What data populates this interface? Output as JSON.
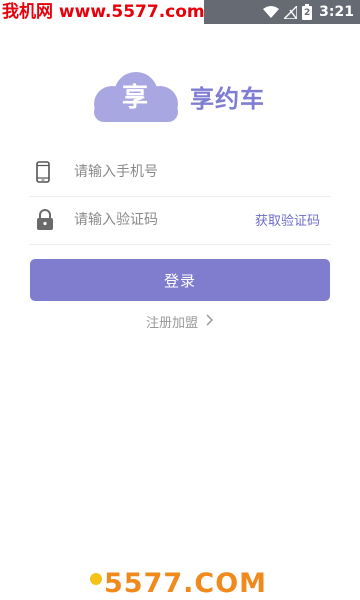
{
  "status_bar": {
    "watermark": "我机网 www.5577.com",
    "time": "3:21",
    "battery_level": "2"
  },
  "logo": {
    "cloud_text": "享",
    "app_name": "享约车"
  },
  "login_form": {
    "phone_placeholder": "请输入手机号",
    "code_placeholder": "请输入验证码",
    "get_code_label": "获取验证码",
    "login_label": "登录",
    "register_label": "注册加盟"
  },
  "bottom_watermark": {
    "text": "5577.COM"
  },
  "colors": {
    "accent": "#807dcf",
    "accent_text": "#6f6cc8",
    "status_bar": "#666a73",
    "watermark_red": "#e8000b",
    "watermark_orange": "#f08a1c"
  }
}
